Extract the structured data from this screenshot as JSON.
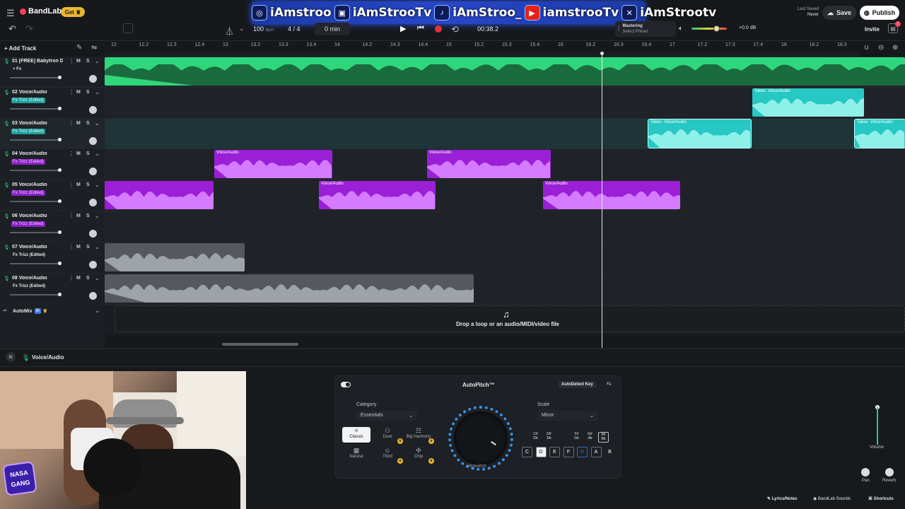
{
  "app": {
    "name": "BandLab",
    "get_label": "Get"
  },
  "social": [
    {
      "icon": "instagram-icon",
      "handle": "iAmstroo"
    },
    {
      "icon": "twitch-icon",
      "handle": "iAmStrooTv"
    },
    {
      "icon": "tiktok-icon",
      "handle": "iAmStroo_"
    },
    {
      "icon": "youtube-icon",
      "handle": "iamstrooTv"
    },
    {
      "icon": "x-icon",
      "handle": "iAmStrootv"
    }
  ],
  "transport": {
    "bpm": "100",
    "bpm_unit": "bpm",
    "time_sig": "4 / 4",
    "length": "0 min",
    "time": "00:38.2"
  },
  "mastering": {
    "title": "Mastering",
    "preset": "Select Preset"
  },
  "volume": {
    "db": "+0.0 dB"
  },
  "save_status": {
    "label": "Last Saved",
    "value": "Never"
  },
  "buttons": {
    "save": "Save",
    "publish": "Publish",
    "invite": "Invite",
    "add_track": "Add Track",
    "notif_count": "5"
  },
  "ruler": [
    "12",
    "12.2",
    "12.3",
    "12.4",
    "13",
    "13.2",
    "13.3",
    "13.4",
    "14",
    "14.2",
    "14.3",
    "14.4",
    "15",
    "15.2",
    "15.3",
    "15.4",
    "16",
    "16.2",
    "16.3",
    "16.4",
    "17",
    "17.2",
    "17.3",
    "17.4",
    "18",
    "18.2",
    "18.3"
  ],
  "tracks": [
    {
      "num": "01",
      "name": "[FREE] Babytron D...",
      "fx": "+ Fx",
      "m": "M",
      "s": "S"
    },
    {
      "num": "02",
      "name": "Voice/Audio",
      "fx": "Fx Trizz (Edited)",
      "m": "M",
      "s": "S"
    },
    {
      "num": "03",
      "name": "Voice/Audio",
      "fx": "Fx Trizz (Edited)",
      "m": "M",
      "s": "S"
    },
    {
      "num": "04",
      "name": "Voice/Audio",
      "fx": "Fx Trizz (Edited)",
      "m": "M",
      "s": "S"
    },
    {
      "num": "05",
      "name": "Voice/Audio",
      "fx": "Fx Trizz (Edited)",
      "m": "M",
      "s": "S"
    },
    {
      "num": "06",
      "name": "Voice/Audio",
      "fx": "Fx Trizz (Edited)",
      "m": "M",
      "s": "S"
    },
    {
      "num": "07",
      "name": "Voice/Audio",
      "fx": "Fx Trizz (Edited)",
      "m": "M",
      "s": "S"
    },
    {
      "num": "08",
      "name": "Voice/Audio",
      "fx": "Fx Trizz (Edited)",
      "m": "M",
      "s": "S"
    }
  ],
  "clip_labels": {
    "takes": "Takes",
    "voice": "Voice/Audio"
  },
  "automix": {
    "label": "AutoMix",
    "badge": "AI"
  },
  "drop_hint": "Drop a loop or an audio/MIDI/video file",
  "editor": {
    "track_title": "Voice/Audio"
  },
  "autopitch": {
    "title": "AutoPitch™",
    "autodetect": "AutoDetect Key",
    "category_label": "Category",
    "category_value": "Essentials",
    "scale_label": "Scale",
    "scale_value": "Minor",
    "knob_label": "Heaviest",
    "presets": [
      "Classic",
      "Duet",
      "Big Harmony",
      "Natural",
      "Third",
      "Chip"
    ],
    "sharps": [
      "C#\nDb",
      "D#\nEb",
      "F#\nGb",
      "G#\nAb",
      "A#\nBb"
    ],
    "keys": [
      "C",
      "D",
      "E",
      "F",
      "G",
      "A",
      "B"
    ]
  },
  "mix": {
    "volume": "Volume",
    "pan": "Pan",
    "reverb": "Reverb"
  },
  "footer": {
    "lyrics": "Lyrics/Notes",
    "sounds": "BandLab Sounds",
    "shortcuts": "Shortcuts"
  },
  "webcam": {
    "overlay_text": "NASA GANG"
  },
  "colors": {
    "green": "#2fd77c",
    "teal": "#27c8c3",
    "purple": "#9a1fd6",
    "gray": "#55595e",
    "accent": "#f2405a"
  }
}
